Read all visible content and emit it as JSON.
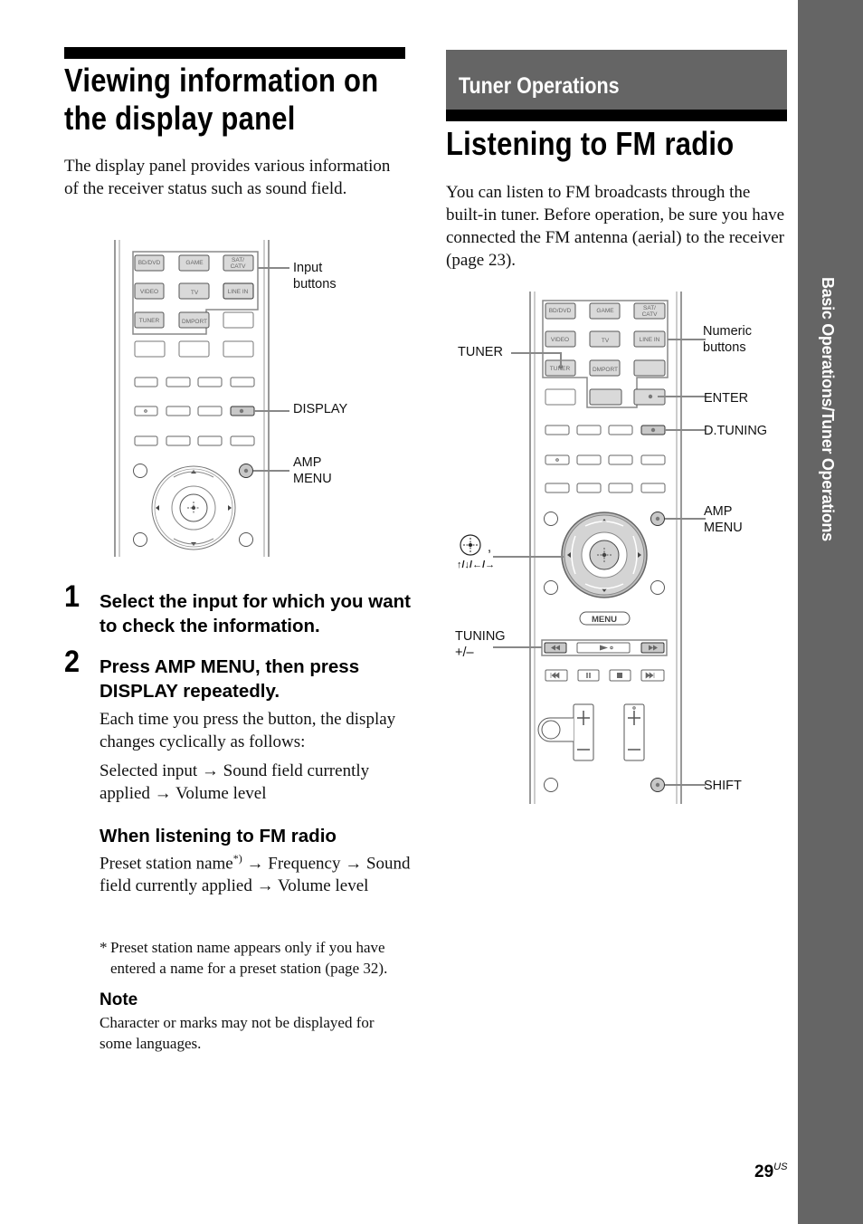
{
  "side_tab": {
    "label": "Basic Operations/Tuner Operations"
  },
  "left": {
    "title_line1": "Viewing information on",
    "title_line2": "the display panel",
    "intro": "The display panel provides various information of the receiver status such as sound field.",
    "remote": {
      "input_buttons": [
        "BD/DVD",
        "GAME",
        "SAT/ CATV",
        "VIDEO",
        "TV",
        "LINE IN",
        "TUNER",
        "DMPORT"
      ],
      "callouts": {
        "input_buttons": "Input buttons",
        "display": "DISPLAY",
        "amp_menu": "AMP MENU"
      }
    },
    "steps": [
      {
        "number": "1",
        "title": "Select the input for which you want to check the information."
      },
      {
        "number": "2",
        "title": "Press AMP MENU, then press DISPLAY repeatedly.",
        "body": "Each time you press the button, the display changes cyclically as follows:",
        "sequence": "Selected input → Sound field currently applied → Volume level"
      }
    ],
    "fm_subhead": "When listening to FM radio",
    "fm_sequence_part1": "Preset station name",
    "fm_sequence_sup": "*)",
    "fm_sequence_part2": " → Frequency → Sound field currently applied → Volume level",
    "footnote_mark": "*",
    "footnote": "Preset station name appears only if you have entered a name for a preset station (page 32).",
    "note_heading": "Note",
    "note_body": "Character or marks may not be displayed for some languages."
  },
  "right": {
    "section_label": "Tuner Operations",
    "title": "Listening to FM radio",
    "intro": "You can listen to FM broadcasts through the built-in tuner. Before operation, be sure you have connected the FM antenna (aerial) to the receiver (page 23).",
    "remote": {
      "input_buttons": [
        "BD/DVD",
        "GAME",
        "SAT/ CATV",
        "VIDEO",
        "TV",
        "LINE IN",
        "TUNER",
        "DMPORT"
      ],
      "menu_label": "MENU",
      "callouts": {
        "tuner": "TUNER",
        "enter_arrows_comma": ",",
        "arrows": "↑/↓/←/→",
        "tuning": "TUNING",
        "tuning_sign": "+/–",
        "numeric": "Numeric buttons",
        "enter": "ENTER",
        "d_tuning": "D.TUNING",
        "amp_menu": "AMP MENU",
        "shift": "SHIFT"
      }
    }
  },
  "footer": {
    "page_number": "29",
    "page_suffix": "US"
  }
}
